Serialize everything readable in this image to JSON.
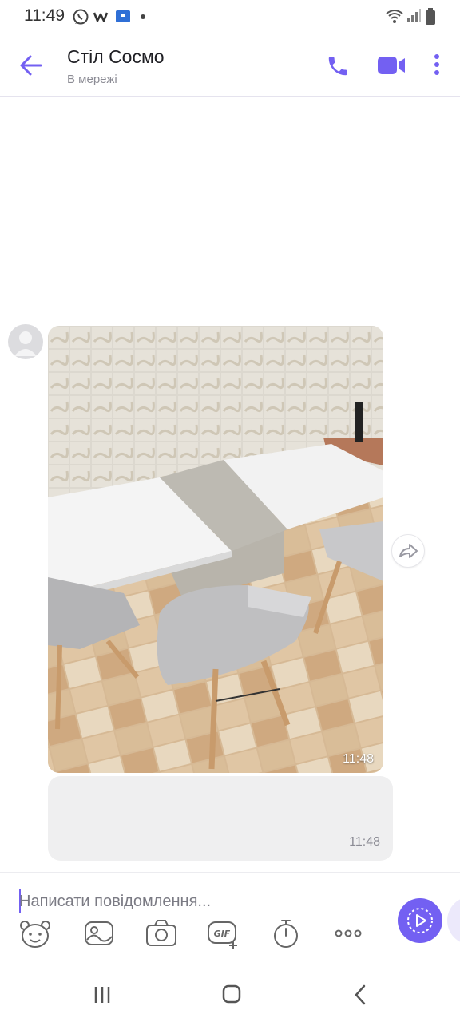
{
  "status_bar": {
    "time": "11:49"
  },
  "header": {
    "title": "Стіл Cocмо",
    "subtitle": "В мережі"
  },
  "messages": [
    {
      "type": "photo",
      "time": "11:48"
    },
    {
      "type": "text",
      "time": "11:48"
    }
  ],
  "composer": {
    "placeholder": "Написати повідомлення..."
  },
  "colors": {
    "accent": "#7360f2",
    "bubble_incoming": "#efeff0"
  }
}
